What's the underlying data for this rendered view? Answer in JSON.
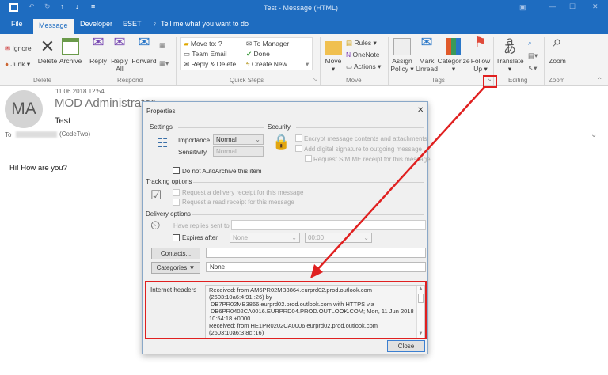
{
  "window": {
    "title": "Test - Message (HTML)"
  },
  "tabs": [
    "File",
    "Message",
    "Developer",
    "ESET"
  ],
  "tell_me": "Tell me what you want to do",
  "ribbon": {
    "delete": {
      "ignore": "Ignore",
      "junk": "Junk",
      "delete": "Delete",
      "archive": "Archive",
      "label": "Delete"
    },
    "respond": {
      "reply": "Reply",
      "reply_all": "Reply All",
      "forward": "Forward",
      "label": "Respond"
    },
    "quick_steps": {
      "items": [
        "Move to: ?",
        "Team Email",
        "Reply & Delete",
        "To Manager",
        "Done",
        "Create New"
      ],
      "label": "Quick Steps"
    },
    "move": {
      "move": "Move",
      "rules": "Rules",
      "onenote": "OneNote",
      "actions": "Actions",
      "label": "Move"
    },
    "tags": {
      "assign_policy": "Assign Policy",
      "mark_unread": "Mark Unread",
      "categorize": "Categorize",
      "follow_up": "Follow Up",
      "label": "Tags"
    },
    "editing": {
      "translate": "Translate",
      "label": "Editing"
    },
    "zoom": {
      "zoom": "Zoom",
      "label": "Zoom"
    }
  },
  "message": {
    "avatar": "MA",
    "date": "11.06.2018 12:54",
    "sender": "MOD Administrator",
    "subject": "Test",
    "to_label": "To",
    "to_suffix": "(CodeTwo)",
    "body": "Hi! How are you?"
  },
  "dialog": {
    "title": "Properties",
    "settings": "Settings",
    "importance_label": "Importance",
    "importance": "Normal",
    "sensitivity_label": "Sensitivity",
    "sensitivity": "Normal",
    "security": "Security",
    "encrypt": "Encrypt message contents and attachments",
    "signature": "Add digital signature to outgoing message",
    "smime": "Request S/MIME receipt for this message",
    "autoarchive": "Do not AutoArchive this item",
    "tracking": "Tracking options",
    "delivery_receipt": "Request a delivery receipt for this message",
    "read_receipt": "Request a read receipt for this message",
    "delivery": "Delivery options",
    "replies": "Have replies sent to",
    "expires": "Expires after",
    "expires_date": "None",
    "expires_time": "00:00",
    "contacts": "Contacts...",
    "categories": "Categories",
    "categories_value": "None",
    "headers_label": "Internet headers",
    "headers": [
      "Received: from AM6PR02MB3864.eurprd02.prod.outlook.com",
      "(2603:10a6:4:91::26) by",
      "DB7PR02MB3866.eurprd02.prod.outlook.com with HTTPS via",
      "DB6PR0402CA0016.EURPRD04.PROD.OUTLOOK.COM; Mon, 11 Jun 2018",
      "10:54:18 +0000",
      "Received: from HE1PR0202CA0006.eurprd02.prod.outlook.com",
      "(2603:10a6:3:8c::16)"
    ],
    "close": "Close"
  },
  "colors": {
    "accent": "#1e6cc0",
    "annotation": "#e02020"
  }
}
